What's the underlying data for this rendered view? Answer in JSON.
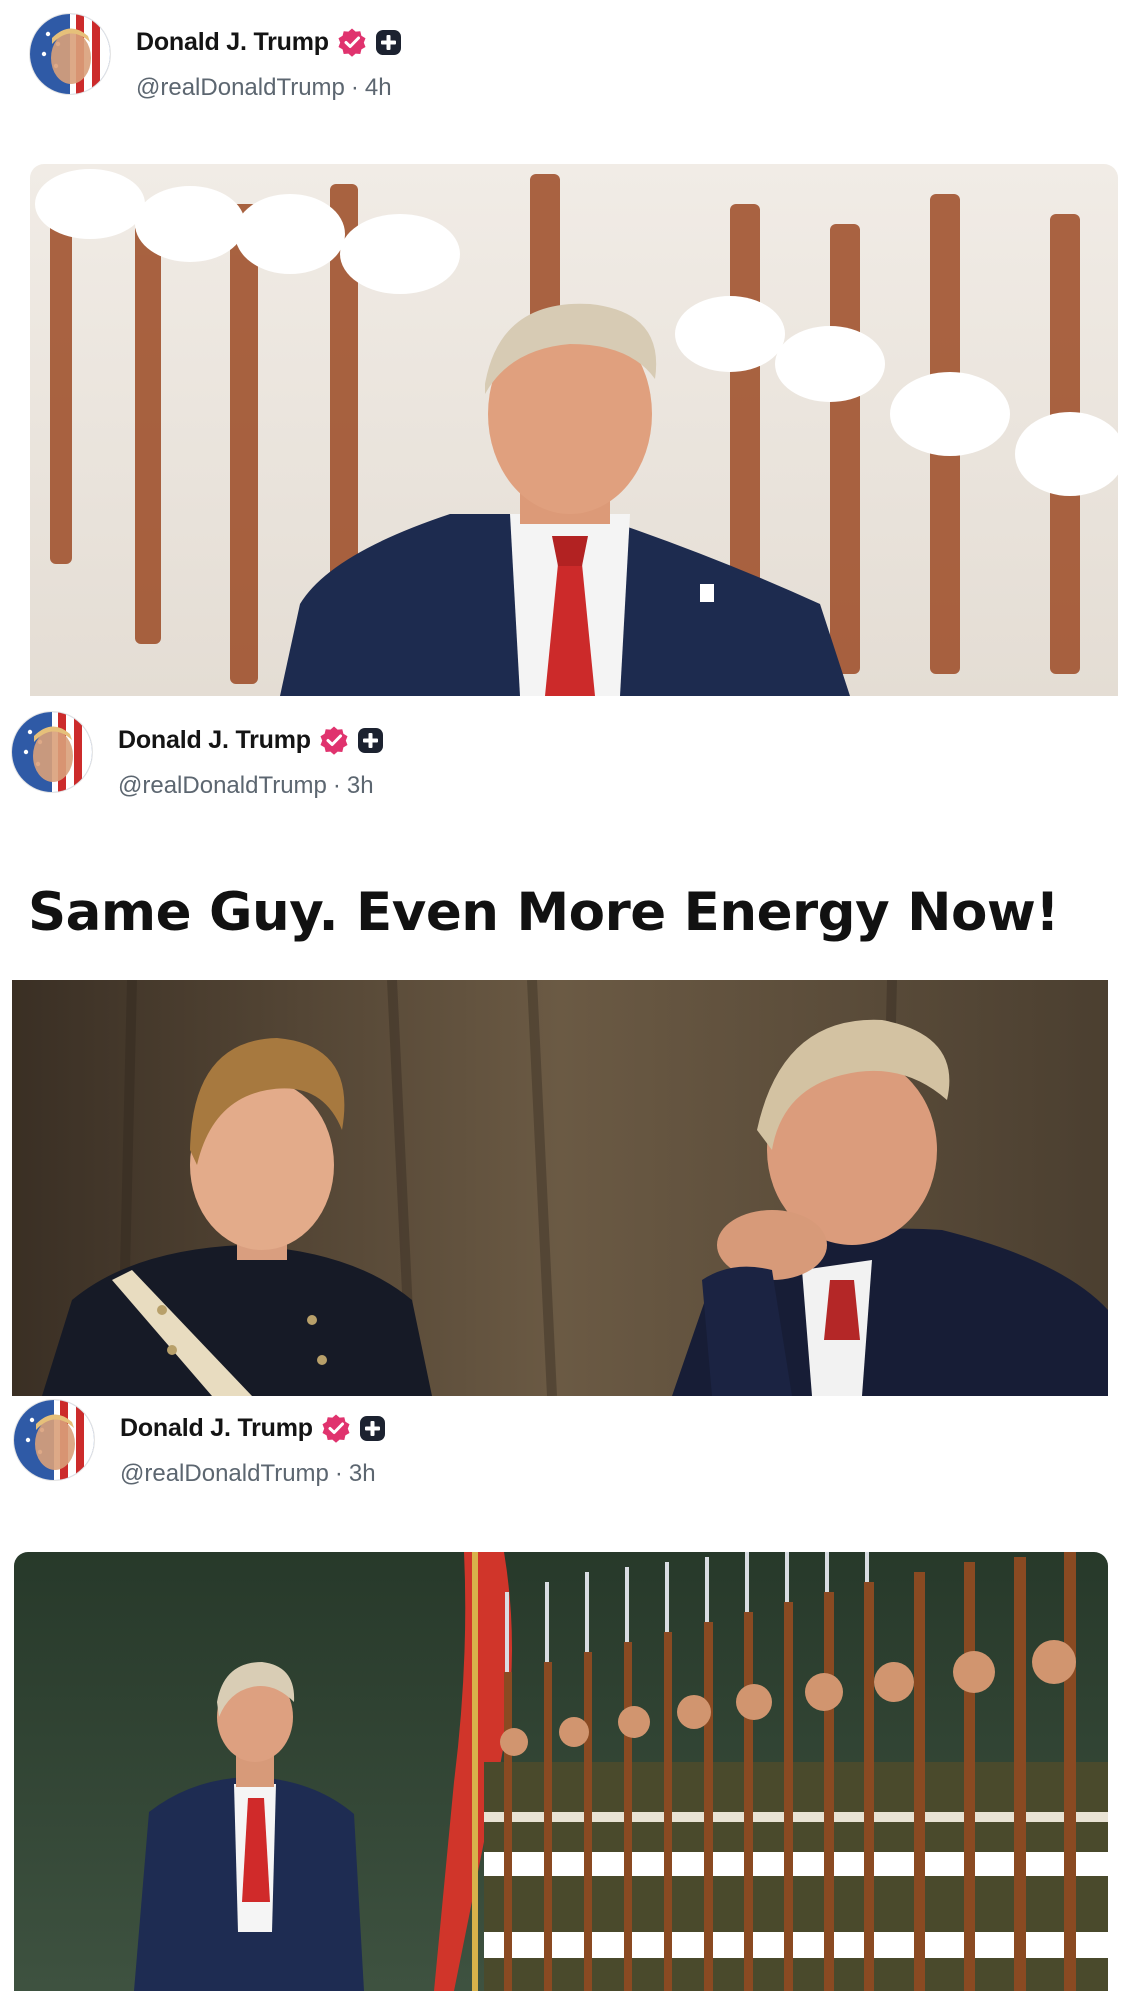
{
  "posts": [
    {
      "author": {
        "display_name": "Donald J. Trump",
        "handle": "@realDonaldTrump",
        "verified": true,
        "badge_color": "#e0336e"
      },
      "separator": "·",
      "timestamp": "4h",
      "media_description": "photo"
    },
    {
      "author": {
        "display_name": "Donald J. Trump",
        "handle": "@realDonaldTrump",
        "verified": true,
        "badge_color": "#e0336e"
      },
      "separator": "·",
      "timestamp": "3h",
      "headline": "Same Guy. Even More Energy Now!",
      "media_description": "photo"
    },
    {
      "author": {
        "display_name": "Donald J. Trump",
        "handle": "@realDonaldTrump",
        "verified": true,
        "badge_color": "#e0336e"
      },
      "separator": "·",
      "timestamp": "3h",
      "media_description": "photo"
    }
  ],
  "icons": {
    "verified": "verified-badge-icon",
    "plus": "plus-badge-icon"
  }
}
